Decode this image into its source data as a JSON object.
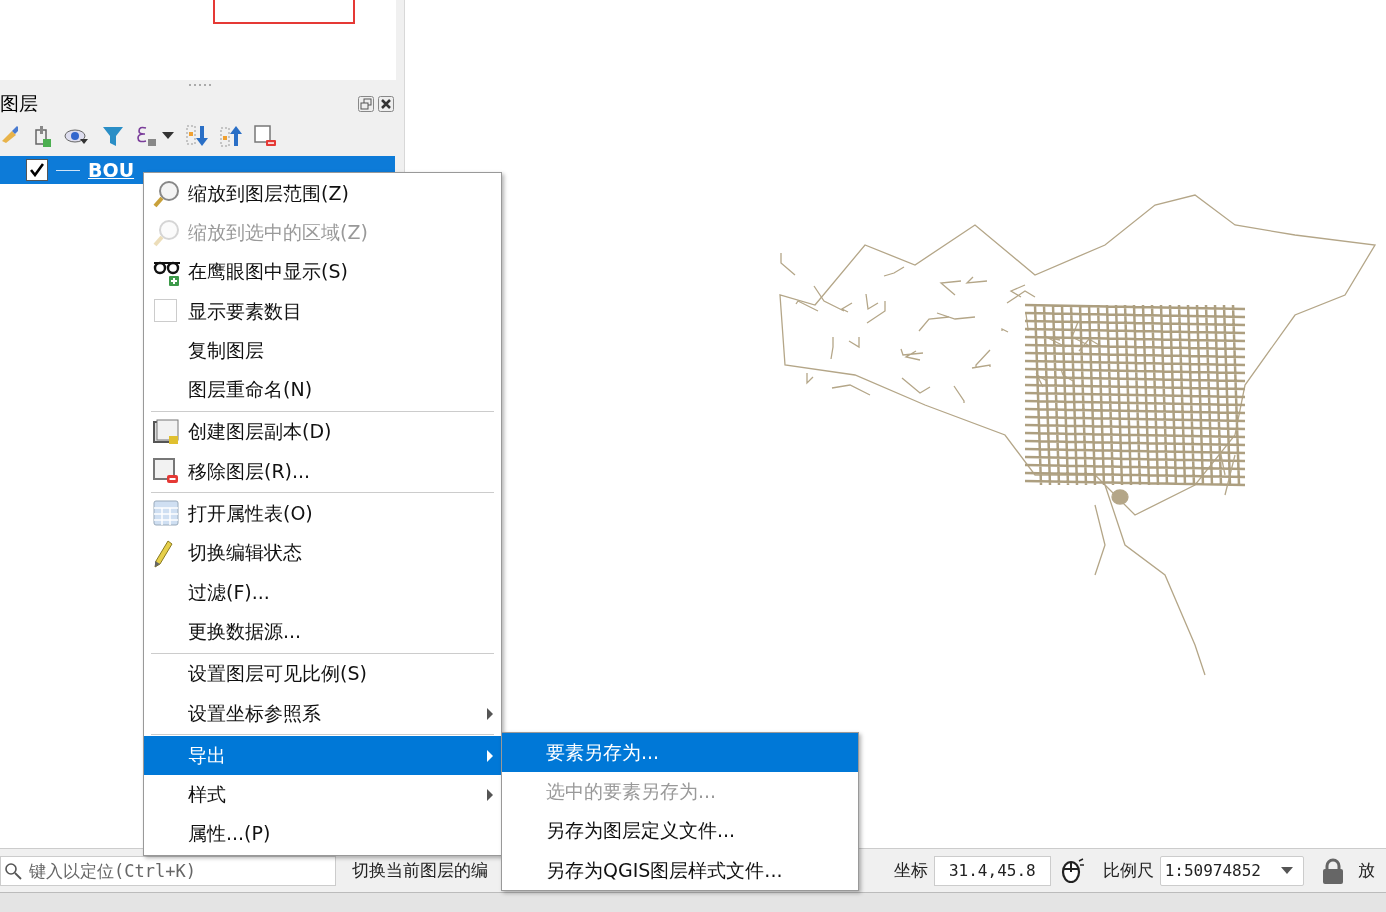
{
  "layers_panel": {
    "title": "图层",
    "layers": [
      {
        "name": "BOU",
        "checked": true,
        "selected": true
      }
    ]
  },
  "context_menu": {
    "sections": [
      [
        {
          "kind": "icon",
          "label": "缩放到图层范围(Z)",
          "disabled": false,
          "selected": false,
          "has_submenu": false
        },
        {
          "kind": "icon",
          "label": "缩放到选中的区域(Z)",
          "disabled": true,
          "selected": false,
          "has_submenu": false
        },
        {
          "kind": "icon",
          "label": "在鹰眼图中显示(S)",
          "disabled": false,
          "selected": false,
          "has_submenu": false
        },
        {
          "kind": "checkbox",
          "label": "显示要素数目",
          "checked": false,
          "disabled": false,
          "selected": false,
          "has_submenu": false
        },
        {
          "kind": "text",
          "label": "复制图层",
          "disabled": false,
          "selected": false,
          "has_submenu": false
        },
        {
          "kind": "text",
          "label": "图层重命名(N)",
          "disabled": false,
          "selected": false,
          "has_submenu": false
        }
      ],
      [
        {
          "kind": "icon",
          "label": "创建图层副本(D)",
          "disabled": false,
          "selected": false,
          "has_submenu": false
        },
        {
          "kind": "icon",
          "label": "移除图层(R)...",
          "disabled": false,
          "selected": false,
          "has_submenu": false
        }
      ],
      [
        {
          "kind": "icon",
          "label": "打开属性表(O)",
          "disabled": false,
          "selected": false,
          "has_submenu": false
        },
        {
          "kind": "icon",
          "label": "切换编辑状态",
          "disabled": false,
          "selected": false,
          "has_submenu": false
        },
        {
          "kind": "text",
          "label": "过滤(F)...",
          "disabled": false,
          "selected": false,
          "has_submenu": false
        },
        {
          "kind": "text",
          "label": "更换数据源...",
          "disabled": false,
          "selected": false,
          "has_submenu": false
        }
      ],
      [
        {
          "kind": "text",
          "label": "设置图层可见比例(S)",
          "disabled": false,
          "selected": false,
          "has_submenu": false
        },
        {
          "kind": "text",
          "label": "设置坐标参照系",
          "disabled": false,
          "selected": false,
          "has_submenu": true
        }
      ],
      [
        {
          "kind": "text",
          "label": "导出",
          "disabled": false,
          "selected": true,
          "has_submenu": true
        },
        {
          "kind": "text",
          "label": "样式",
          "disabled": false,
          "selected": false,
          "has_submenu": true
        },
        {
          "kind": "text",
          "label": "属性...(P)",
          "disabled": false,
          "selected": false,
          "has_submenu": false
        }
      ]
    ]
  },
  "submenu": {
    "items": [
      {
        "label": "要素另存为...",
        "disabled": false,
        "selected": true
      },
      {
        "label": "选中的要素另存为...",
        "disabled": true,
        "selected": false
      },
      {
        "label": "另存为图层定义文件...",
        "disabled": false,
        "selected": false
      },
      {
        "label": "另存为QGIS图层样式文件...",
        "disabled": false,
        "selected": false
      }
    ]
  },
  "status_bar": {
    "search": {
      "placeholder": "键入以定位(Ctrl+K)"
    },
    "message": "切换当前图层的编",
    "coordinate": {
      "label": "坐标",
      "value": "31.4,45.8"
    },
    "scale": {
      "label": "比例尺",
      "value": "1:50974852"
    },
    "magnifier_label": "放"
  }
}
